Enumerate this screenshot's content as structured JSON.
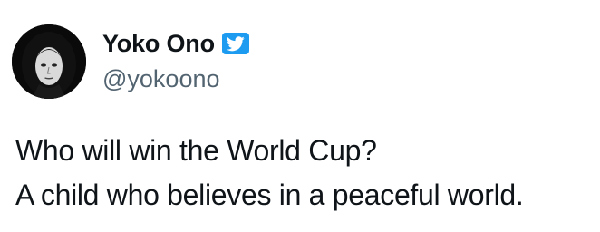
{
  "author": {
    "display_name": "Yoko Ono",
    "handle": "@yokoono",
    "verified": true,
    "badge_icon": "twitter-bird-icon",
    "badge_color": "#1d9bf0",
    "avatar_icon": "profile-photo"
  },
  "tweet": {
    "lines": [
      "Who will win the World Cup?",
      "A child who believes in a peaceful world."
    ]
  },
  "colors": {
    "text": "#0f1419",
    "secondary_text": "#536471",
    "background": "#ffffff"
  }
}
